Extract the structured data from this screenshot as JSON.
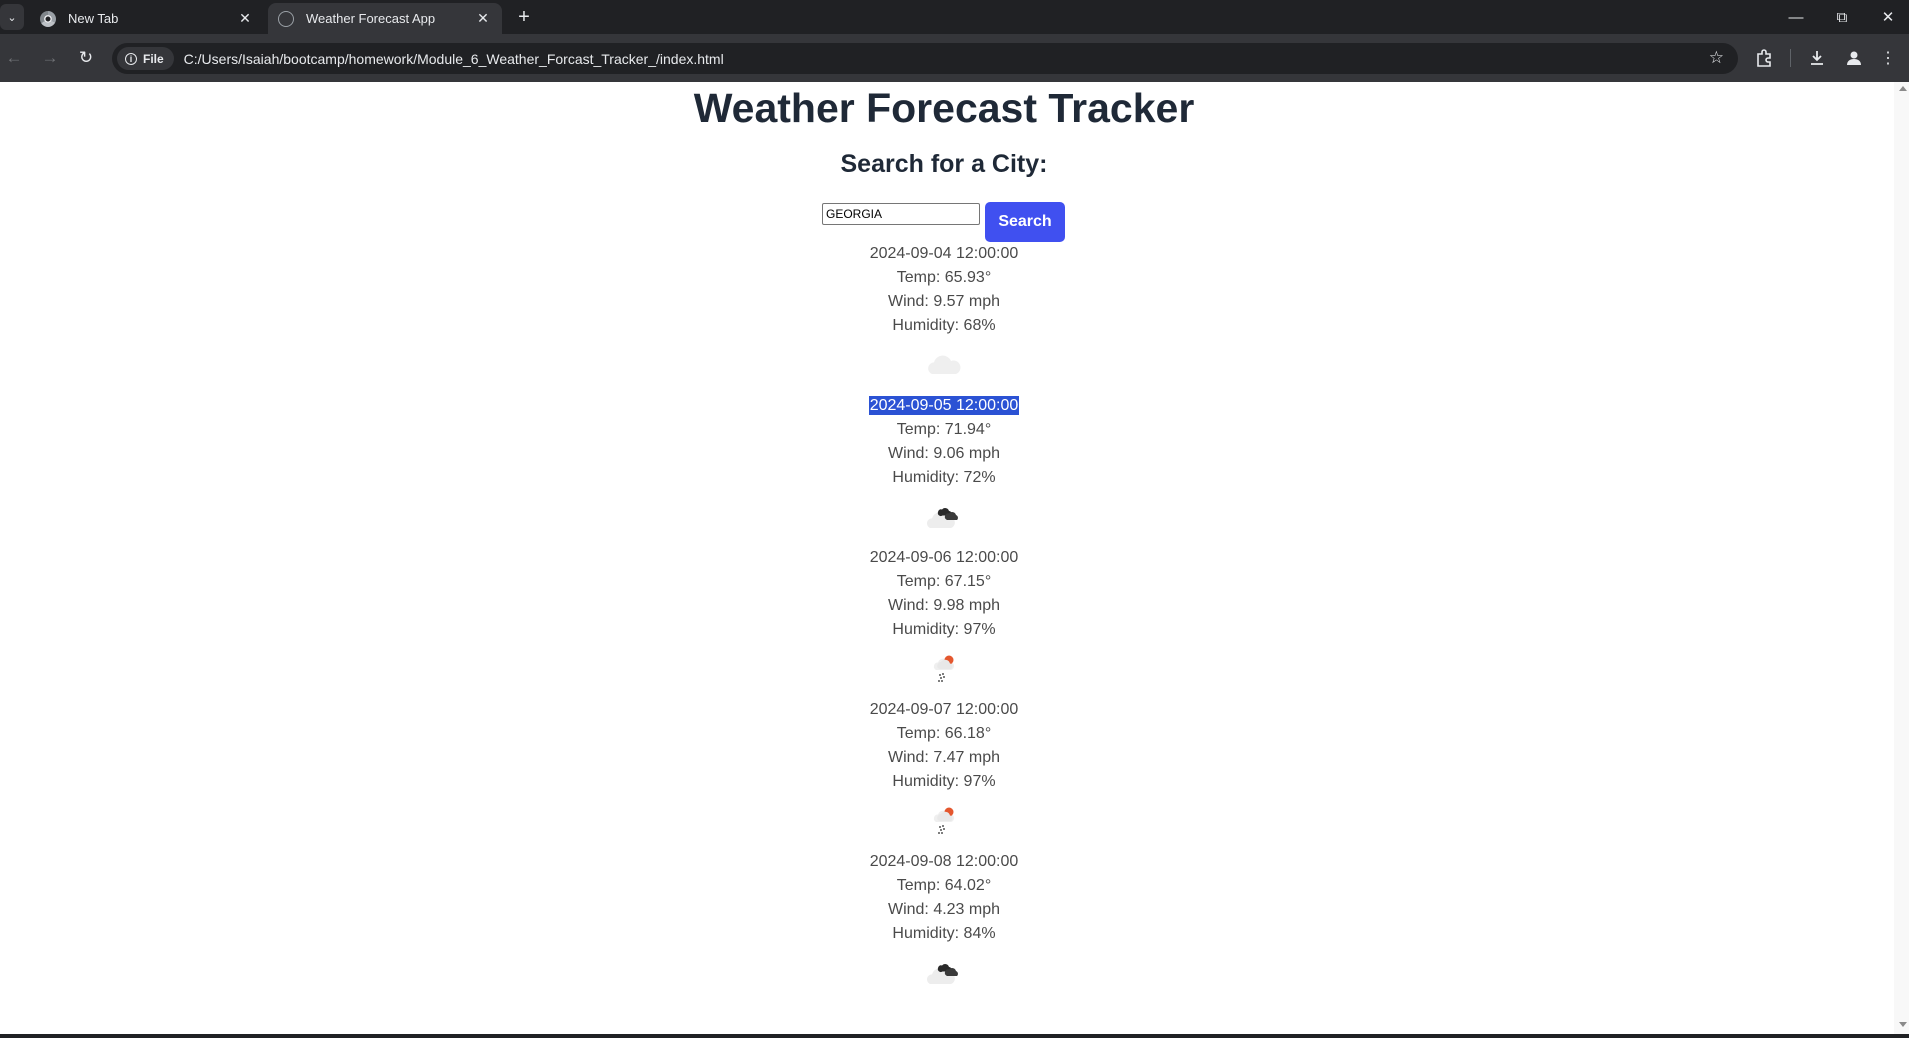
{
  "browser": {
    "tabs": [
      {
        "title": "New Tab",
        "active": false
      },
      {
        "title": "Weather Forecast App",
        "active": true
      }
    ],
    "site_chip_label": "File",
    "url": "C:/Users/Isaiah/bootcamp/homework/Module_6_Weather_Forcast_Tracker_/index.html"
  },
  "page": {
    "title": "Weather Forecast Tracker",
    "search_heading": "Search for a City:",
    "search_value": "GEORGIA",
    "search_button": "Search",
    "forecasts": [
      {
        "date": "2024-09-04 12:00:00",
        "temp": "Temp: 65.93°",
        "wind": "Wind: 9.57 mph",
        "humidity": "Humidity: 68%",
        "icon": "cloud-icon",
        "selected": false
      },
      {
        "date": "2024-09-05 12:00:00",
        "temp": "Temp: 71.94°",
        "wind": "Wind: 9.06 mph",
        "humidity": "Humidity: 72%",
        "icon": "broken-clouds-icon",
        "selected": true
      },
      {
        "date": "2024-09-06 12:00:00",
        "temp": "Temp: 67.15°",
        "wind": "Wind: 9.98 mph",
        "humidity": "Humidity: 97%",
        "icon": "rain-icon",
        "selected": false
      },
      {
        "date": "2024-09-07 12:00:00",
        "temp": "Temp: 66.18°",
        "wind": "Wind: 7.47 mph",
        "humidity": "Humidity: 97%",
        "icon": "rain-icon",
        "selected": false
      },
      {
        "date": "2024-09-08 12:00:00",
        "temp": "Temp: 64.02°",
        "wind": "Wind: 4.23 mph",
        "humidity": "Humidity: 84%",
        "icon": "broken-clouds-icon",
        "selected": false
      }
    ]
  },
  "colors": {
    "search_button": "#4050f0",
    "selection": "#2b52d4",
    "heading": "#1f2937",
    "chrome_dark": "#202124",
    "chrome_toolbar": "#35363a"
  }
}
